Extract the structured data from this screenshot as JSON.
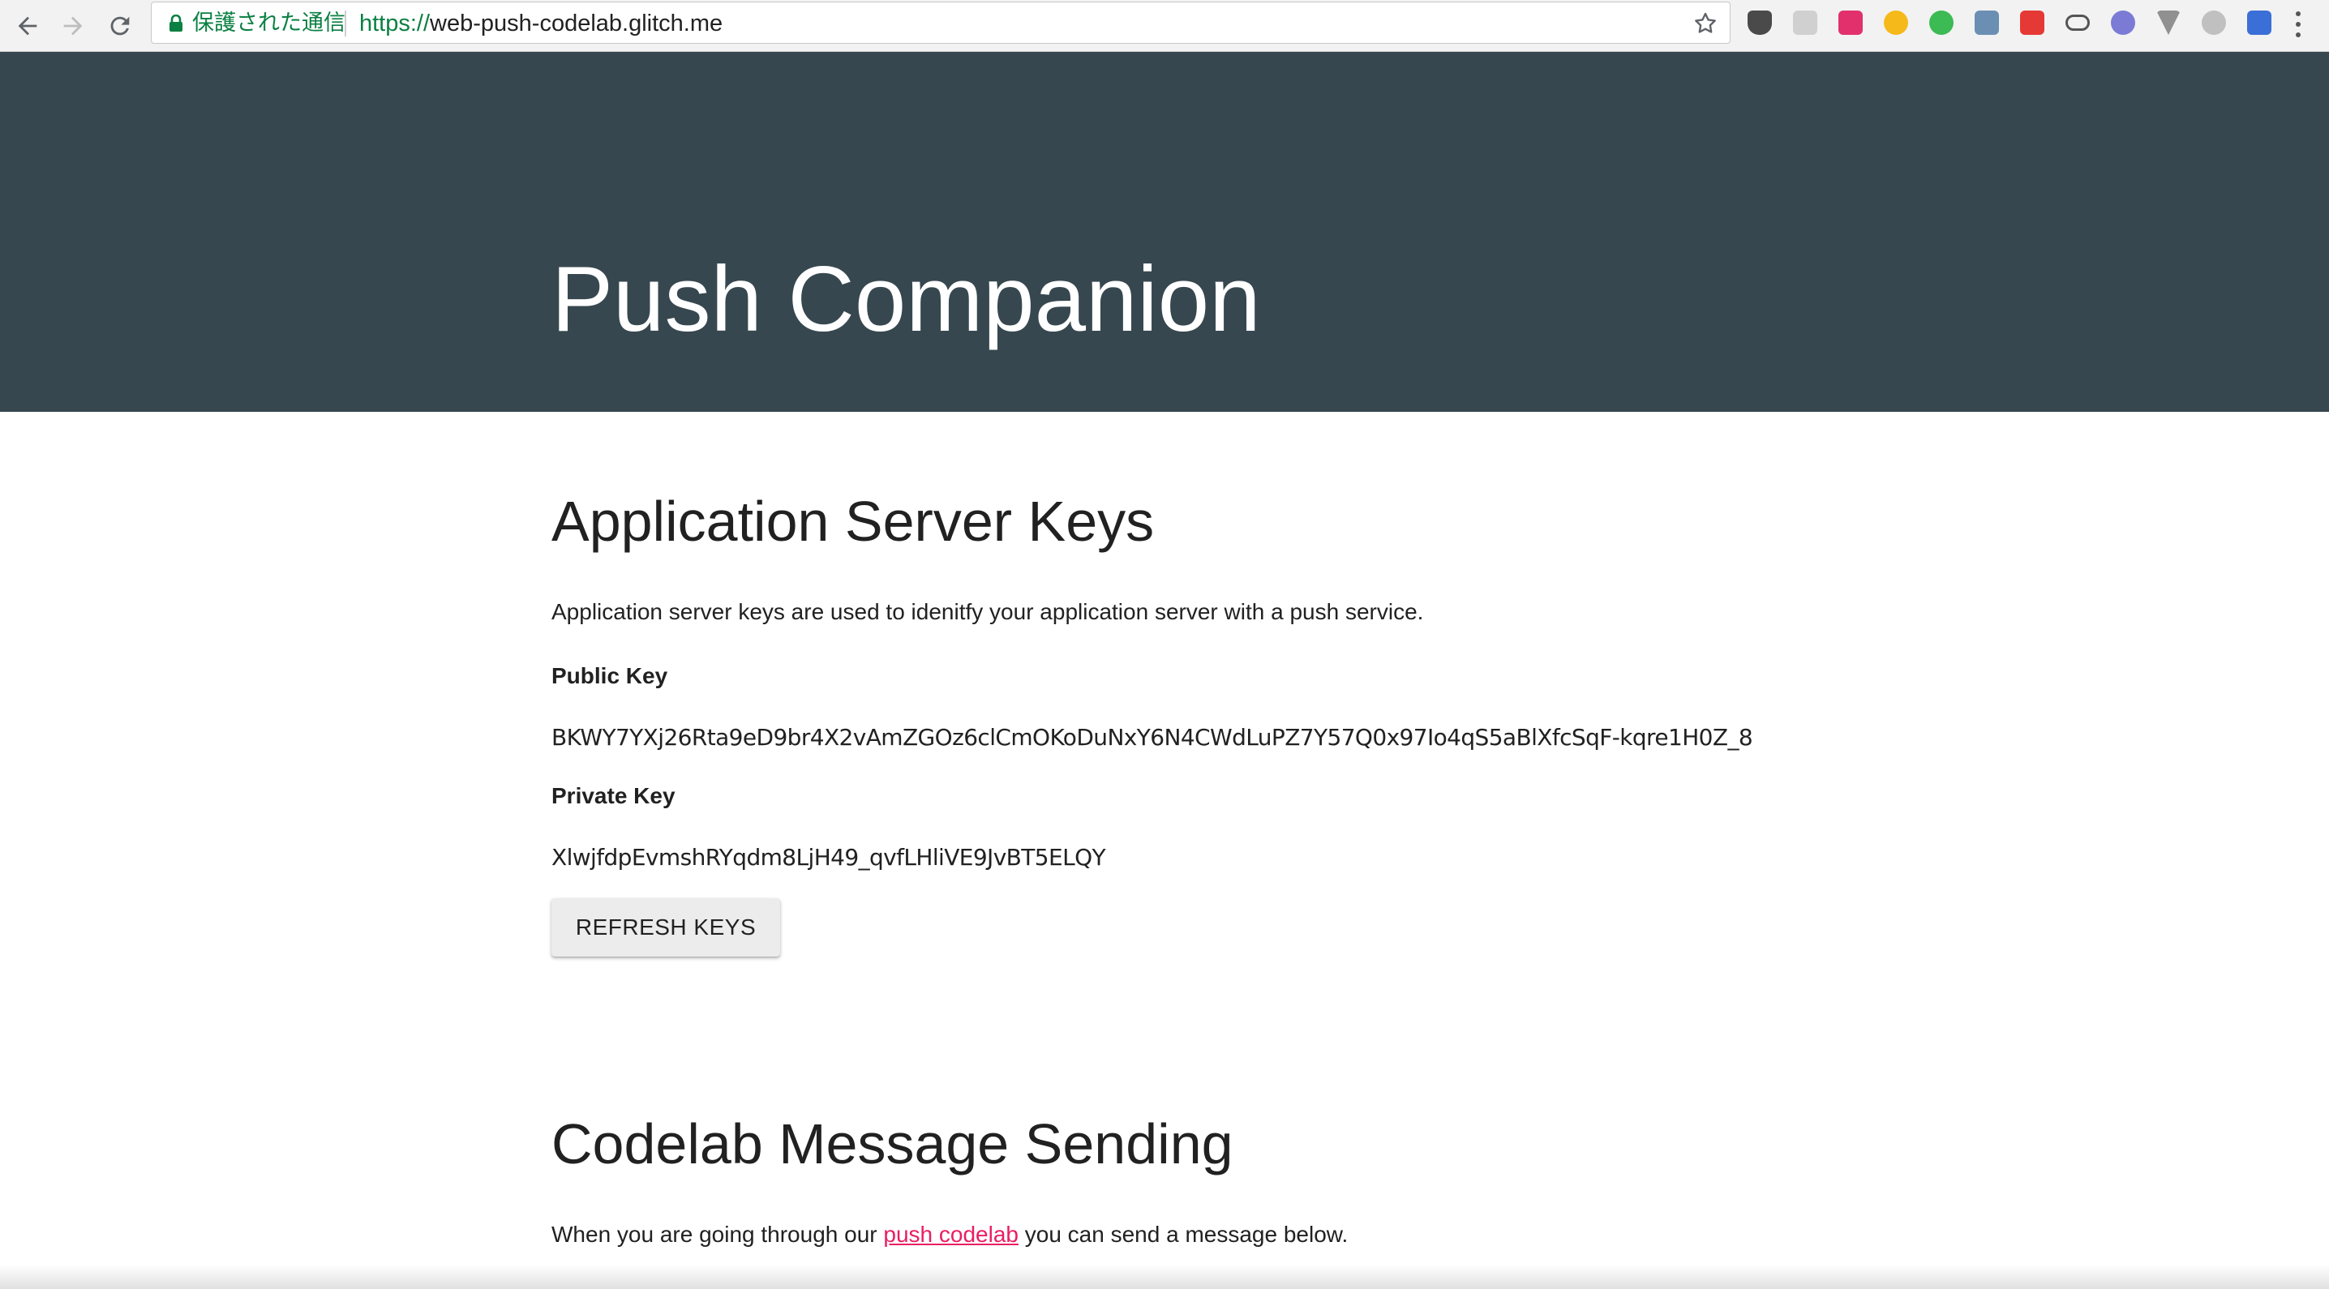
{
  "browser": {
    "secure_label": "保護された通信",
    "url_scheme": "https://",
    "url_host": "web-push-codelab.glitch.me",
    "extension_colors": [
      "#4a4a4a",
      "#c8c8c8",
      "#e1306c",
      "#f6b91a",
      "#3cba54",
      "#6a8fb3",
      "#e53935",
      "#555555",
      "#7b7bd6",
      "#909090",
      "#c0c0c0",
      "#3b6fd8"
    ]
  },
  "hero": {
    "title": "Push Companion"
  },
  "keys_section": {
    "heading": "Application Server Keys",
    "description": "Application server keys are used to idenitfy your application server with a push service.",
    "public_key_label": "Public Key",
    "public_key": "BKWY7YXj26Rta9eD9br4X2vAmZGOz6clCmOKoDuNxY6N4CWdLuPZ7Y57Q0x97Io4qS5aBlXfcSqF-kqre1H0Z_8",
    "private_key_label": "Private Key",
    "private_key": "XlwjfdpEvmshRYqdm8LjH49_qvfLHliVE9JvBT5ELQY",
    "refresh_button": "REFRESH KEYS"
  },
  "message_section": {
    "heading": "Codelab Message Sending",
    "text_before_link": "When you are going through our ",
    "link_text": "push codelab",
    "text_after_link": " you can send a message below."
  },
  "colors": {
    "hero_bg": "#37474f",
    "link": "#e91e63",
    "secure_green": "#0b8043"
  }
}
